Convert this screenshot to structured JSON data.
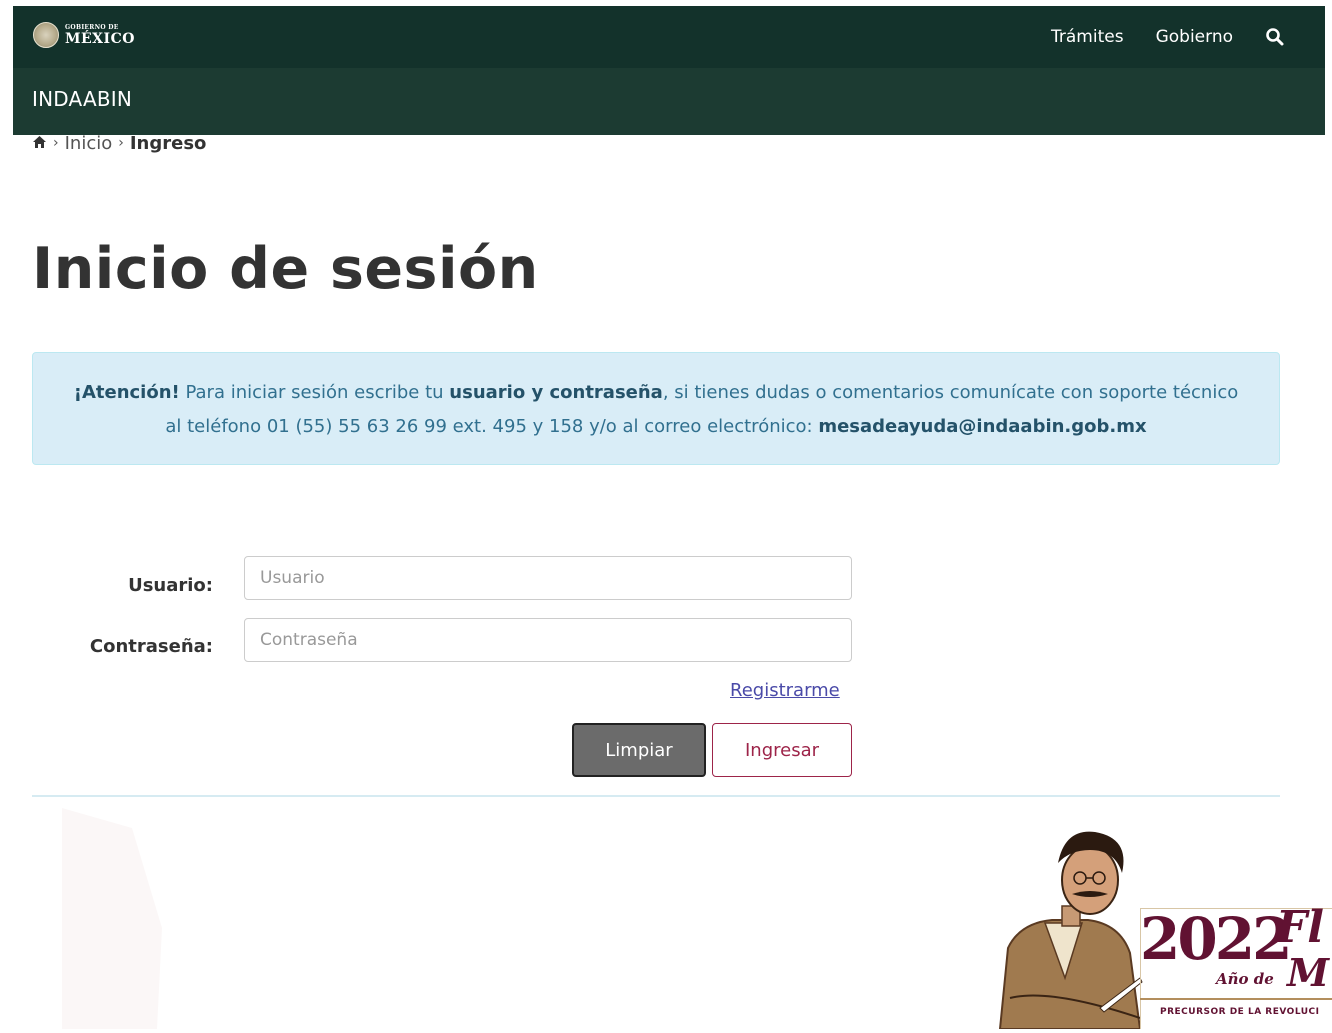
{
  "header": {
    "logo": {
      "small_text": "GOBIERNO DE",
      "big_text": "MÉXICO",
      "icon": "national-seal-icon"
    },
    "nav": [
      {
        "label": "Trámites"
      },
      {
        "label": "Gobierno"
      }
    ],
    "search_icon": "search-icon"
  },
  "subheader": {
    "title": "INDAABIN"
  },
  "breadcrumb": {
    "home_icon": "home-icon",
    "items": [
      {
        "label": "Inicio"
      },
      {
        "label": "Ingreso"
      }
    ]
  },
  "page": {
    "title": "Inicio de sesión"
  },
  "alert": {
    "strong_intro": "¡Atención!",
    "text_1": " Para iniciar sesión escribe tu ",
    "strong_credentials": "usuario y contraseña",
    "text_2": ", si tienes dudas o comentarios comunícate con soporte técnico al teléfono 01 (55) 55 63 26 99 ext. 495 y 158 y/o al correo electrónico: ",
    "strong_email": "mesadeayuda@indaabin.gob.mx"
  },
  "form": {
    "username_label": "Usuario:",
    "username_placeholder": "Usuario",
    "username_value": "",
    "password_label": "Contraseña:",
    "password_placeholder": "Contraseña",
    "password_value": "",
    "register_link": "Registrarme",
    "clear_button": "Limpiar",
    "login_button": "Ingresar"
  },
  "banner": {
    "year": "2022",
    "word_1": "Fl",
    "ano": "Año de",
    "word_2": "M",
    "tagline": "PRECURSOR DE LA REVOLUCI"
  },
  "colors": {
    "header_bg": "#13322b",
    "subheader_bg": "#1c3b32",
    "alert_bg": "#d9edf7",
    "alert_text": "#31708f",
    "accent": "#9d2449",
    "banner_text": "#611232"
  }
}
